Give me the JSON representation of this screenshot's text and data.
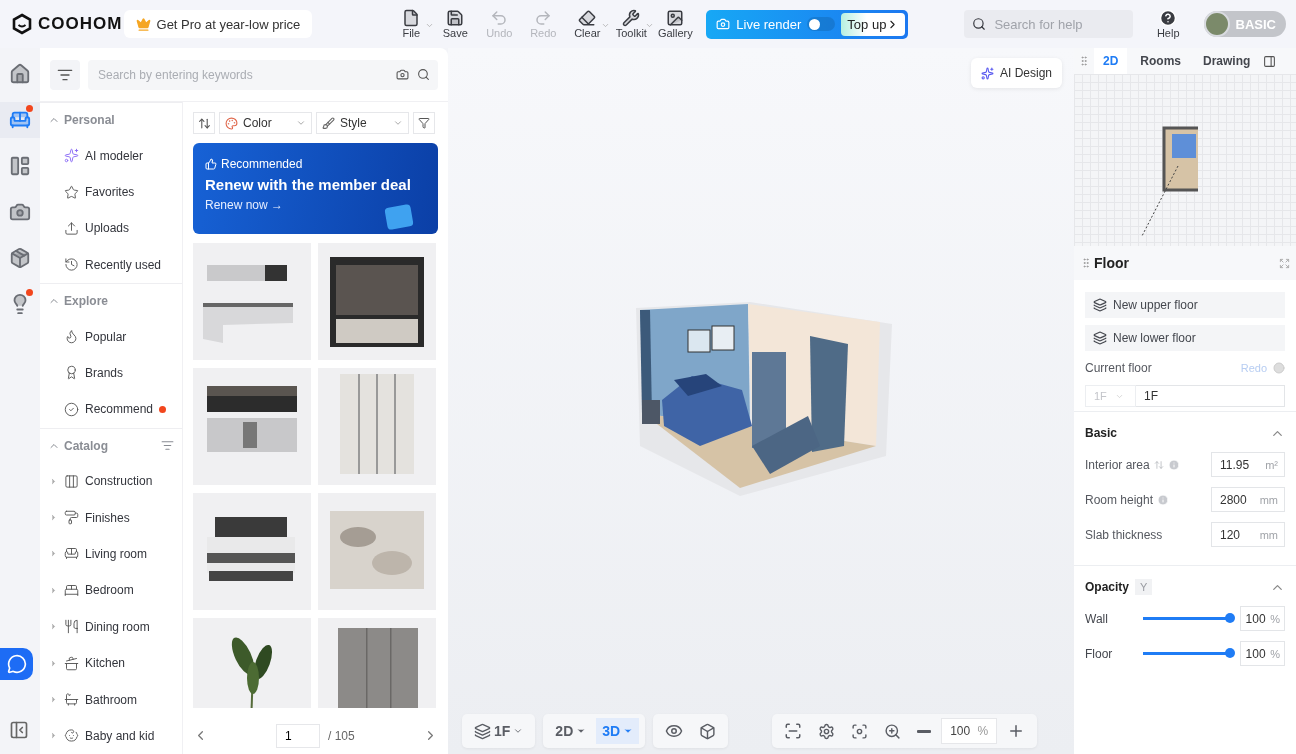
{
  "topbar": {
    "logo": "COOHOM",
    "promo": "Get Pro at year-low price",
    "tools": [
      {
        "kind": "file",
        "label": "File",
        "disabled": false,
        "dropdown": true
      },
      {
        "kind": "save",
        "label": "Save",
        "disabled": false,
        "dropdown": false
      },
      {
        "kind": "undo",
        "label": "Undo",
        "disabled": true,
        "dropdown": false
      },
      {
        "kind": "redo",
        "label": "Redo",
        "disabled": true,
        "dropdown": false
      },
      {
        "kind": "clear",
        "label": "Clear",
        "disabled": false,
        "dropdown": true
      },
      {
        "kind": "toolkit",
        "label": "Toolkit",
        "disabled": false,
        "dropdown": true
      },
      {
        "kind": "gallery",
        "label": "Gallery",
        "disabled": false,
        "dropdown": false
      }
    ],
    "live_render": {
      "label": "Live render",
      "on": false,
      "top_up": "Top up"
    },
    "search": {
      "placeholder": "Search for help"
    },
    "help": "Help",
    "plan": "BASIC"
  },
  "rail": [
    {
      "kind": "house",
      "selected": false,
      "badge": false
    },
    {
      "kind": "sofa",
      "selected": true,
      "badge": true
    },
    {
      "kind": "plan",
      "selected": false,
      "badge": false
    },
    {
      "kind": "camera",
      "selected": false,
      "badge": false
    },
    {
      "kind": "box",
      "selected": false,
      "badge": false
    },
    {
      "kind": "bulb",
      "selected": false,
      "badge": true
    }
  ],
  "library": {
    "search": {
      "placeholder": "Search by entering keywords"
    },
    "sections": [
      {
        "title": "Personal",
        "expanded": true,
        "items": [
          {
            "kind": "ai",
            "label": "AI modeler",
            "badge": false,
            "has_children": false
          },
          {
            "kind": "star",
            "label": "Favorites",
            "badge": false,
            "has_children": false
          },
          {
            "kind": "upload",
            "label": "Uploads",
            "badge": false,
            "has_children": false
          },
          {
            "kind": "history",
            "label": "Recently used",
            "badge": false,
            "has_children": false
          }
        ]
      },
      {
        "title": "Explore",
        "expanded": true,
        "items": [
          {
            "kind": "flame",
            "label": "Popular",
            "badge": false,
            "has_children": false
          },
          {
            "kind": "brand",
            "label": "Brands",
            "badge": false,
            "has_children": false
          },
          {
            "kind": "check",
            "label": "Recommend",
            "badge": true,
            "has_children": false
          }
        ]
      },
      {
        "title": "Catalog",
        "expanded": true,
        "items": [
          {
            "kind": "arch",
            "label": "Construction",
            "badge": false,
            "has_children": true
          },
          {
            "kind": "roller",
            "label": "Finishes",
            "badge": false,
            "has_children": true
          },
          {
            "kind": "sofa",
            "label": "Living room",
            "badge": false,
            "has_children": true
          },
          {
            "kind": "bed",
            "label": "Bedroom",
            "badge": false,
            "has_children": true
          },
          {
            "kind": "dining",
            "label": "Dining room",
            "badge": false,
            "has_children": true
          },
          {
            "kind": "kitchen",
            "label": "Kitchen",
            "badge": false,
            "has_children": true
          },
          {
            "kind": "bath",
            "label": "Bathroom",
            "badge": false,
            "has_children": true
          },
          {
            "kind": "toy",
            "label": "Baby and kid",
            "badge": false,
            "has_children": true
          }
        ]
      }
    ],
    "filters": [
      {
        "kind": "color",
        "label": "Color"
      },
      {
        "kind": "style",
        "label": "Style"
      }
    ],
    "banner": {
      "tag": "Recommended",
      "title": "Renew with the member deal",
      "cta": "Renew now →"
    },
    "products": [
      {
        "kind": "kitchen"
      },
      {
        "kind": "wardrobe"
      },
      {
        "kind": "cabinet"
      },
      {
        "kind": "closet"
      },
      {
        "kind": "bed"
      },
      {
        "kind": "rug"
      },
      {
        "kind": "plant"
      },
      {
        "kind": "cupboard"
      }
    ],
    "pager": {
      "page": "1",
      "total": "/ 105"
    }
  },
  "canvas": {
    "ai_design": "AI Design",
    "floor": "1F",
    "views": [
      {
        "label": "2D",
        "selected": false
      },
      {
        "label": "3D",
        "selected": true
      }
    ],
    "zoom": "100",
    "zoom_unit": "%"
  },
  "panel": {
    "tabs": [
      {
        "label": "2D",
        "selected": true
      },
      {
        "label": "Rooms",
        "selected": false
      },
      {
        "label": "Drawing",
        "selected": false
      }
    ],
    "title": "Floor",
    "actions": [
      "New upper floor",
      "New lower floor"
    ],
    "current_floor": {
      "label": "Current floor",
      "redo": "Redo",
      "redo_disabled": true,
      "select": "1F",
      "value": "1F"
    },
    "basic": {
      "title": "Basic",
      "expanded": true,
      "fields": [
        {
          "label": "Interior area",
          "sortable": true,
          "info": true,
          "value": "11.95",
          "unit": "m²"
        },
        {
          "label": "Room height",
          "sortable": false,
          "info": true,
          "value": "2800",
          "unit": "mm"
        },
        {
          "label": "Slab thickness",
          "sortable": false,
          "info": false,
          "value": "120",
          "unit": "mm"
        }
      ]
    },
    "opacity": {
      "title": "Opacity",
      "tag": "Y",
      "expanded": true,
      "sliders": [
        {
          "label": "Wall",
          "level": 1,
          "value": "100",
          "unit": "%"
        },
        {
          "label": "Floor",
          "level": 1,
          "value": "100",
          "unit": "%"
        }
      ]
    }
  }
}
